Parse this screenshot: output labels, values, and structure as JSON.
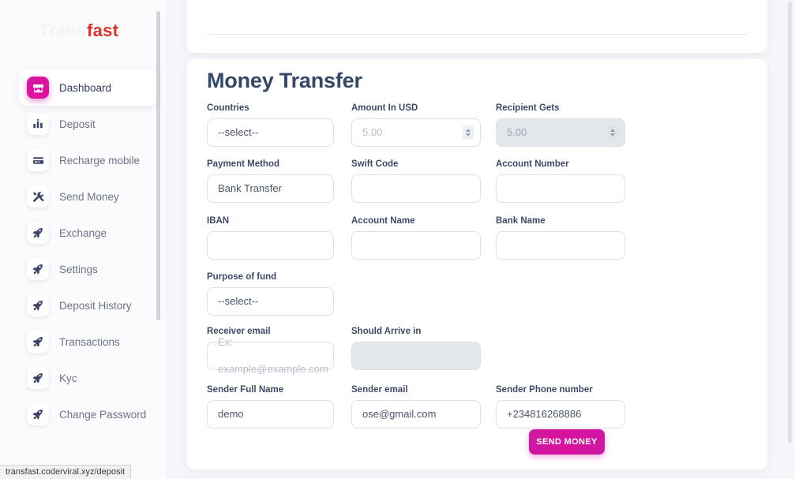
{
  "brand": {
    "name_part1": "Trans",
    "name_part2": "fast"
  },
  "sidebar": {
    "items": [
      {
        "label": "Dashboard",
        "icon": "store-icon",
        "active": true
      },
      {
        "label": "Deposit",
        "icon": "bar-chart-icon",
        "active": false
      },
      {
        "label": "Recharge mobile",
        "icon": "credit-card-icon",
        "active": false
      },
      {
        "label": "Send Money",
        "icon": "tools-icon",
        "active": false
      },
      {
        "label": "Exchange",
        "icon": "rocket-icon",
        "active": false
      },
      {
        "label": "Settings",
        "icon": "rocket-icon",
        "active": false
      },
      {
        "label": "Deposit History",
        "icon": "rocket-icon",
        "active": false
      },
      {
        "label": "Transactions",
        "icon": "rocket-icon",
        "active": false
      },
      {
        "label": "Kyc",
        "icon": "rocket-icon",
        "active": false
      },
      {
        "label": "Change Password",
        "icon": "rocket-icon",
        "active": false
      }
    ]
  },
  "form": {
    "title": "Money Transfer",
    "fields": {
      "countries": {
        "label": "Countries",
        "value": "--select--"
      },
      "amount_usd": {
        "label": "Amount In USD",
        "value": "5.00"
      },
      "recipient_gets": {
        "label": "Recipient Gets",
        "value": "5.00"
      },
      "payment_method": {
        "label": "Payment Method",
        "value": "Bank Transfer"
      },
      "swift_code": {
        "label": "Swift Code",
        "value": ""
      },
      "account_number": {
        "label": "Account Number",
        "value": ""
      },
      "iban": {
        "label": "IBAN",
        "value": ""
      },
      "account_name": {
        "label": "Account Name",
        "value": ""
      },
      "bank_name": {
        "label": "Bank Name",
        "value": ""
      },
      "purpose_of_fund": {
        "label": "Purpose of fund",
        "value": "--select--"
      },
      "receiver_email": {
        "label": "Receiver email",
        "placeholder": "Ex: example@example.com",
        "value": ""
      },
      "should_arrive_in": {
        "label": "Should Arrive in",
        "value": ""
      },
      "sender_full_name": {
        "label": "Sender Full Name",
        "value": "demo"
      },
      "sender_email": {
        "label": "Sender email",
        "value": "ose@gmail.com"
      },
      "sender_phone": {
        "label": "Sender Phone number",
        "value": "+234816268886"
      }
    },
    "submit_label": "SEND MONEY"
  },
  "status_bar": {
    "url": "transfast.coderviral.xyz/deposit"
  },
  "colors": {
    "accent": "#d1189f",
    "brand_red": "#d9342b",
    "heading": "#344767",
    "page_bg": "#f4f6f9"
  }
}
